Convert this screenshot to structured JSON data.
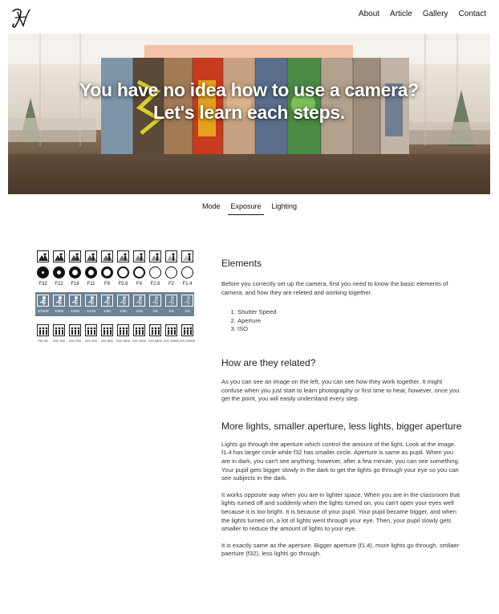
{
  "header": {
    "logo_icon": "signature-logo",
    "nav": [
      "About",
      "Article",
      "Gallery",
      "Contact"
    ]
  },
  "hero": {
    "line1": "You have no idea how to use a camera?",
    "line2": "Let's learn each steps."
  },
  "tabs": [
    {
      "label": "Mode",
      "active": false
    },
    {
      "label": "Exposure",
      "active": true
    },
    {
      "label": "Lighting",
      "active": false
    }
  ],
  "diagram": {
    "apertures": [
      "F32",
      "F22",
      "F16",
      "F11",
      "F8",
      "F5.6",
      "F4",
      "F2.8",
      "F2",
      "F1.4"
    ],
    "shutter_speeds": [
      "1/1000",
      "1/500",
      "1/250",
      "1/125",
      "1/60",
      "1/30",
      "1/15",
      "1/8",
      "1/4",
      "1/2"
    ],
    "iso_values": [
      "ISO 50",
      "ISO 100",
      "ISO 200",
      "ISO 400",
      "ISO 800",
      "ISO 1600",
      "ISO 3200",
      "ISO 6400",
      "ISO 12800",
      "ISO 25600"
    ]
  },
  "sections": [
    {
      "heading": "Elements",
      "paragraphs": [
        "Before you correctly set up the camera, first you need to know the basic elements of camera, and how they are releted and working together."
      ],
      "list": [
        "Shutter Speed",
        "Aperture",
        "ISO"
      ]
    },
    {
      "heading": "How are they related?",
      "paragraphs": [
        "As you can see an image on the left, you can see how they work together. It might confuse when you just start to learn photography or first time to hear, however, once you get the point, you will easily understand every step."
      ]
    },
    {
      "heading": "More lights, smaller aperture, less lights, bigger aperture",
      "paragraphs": [
        "Lights go through the aperture which control the amount of the light. Look at the image. f1.4 has larger circle while f32 has smaller circle. Aperture is same as pupil. When you are in dark, you can't see anything; however, after a few minute, you can see something. Your pupil gets bigger slowly in the dark to get the lights go through your eye so you can see subjects in the dark.",
        "It works opposite way when you are in lighter space. When you are in the classroom that lights turned off and suddenly when the lights turned on, you can't open your eyes well because it is too bright. It is because of your pupil. Your pupil became bigger, and when the lights turned on, a lot of lights went through your eye. Then, your pupil slowly gets smaller to reduce the amount of lights to your eye.",
        "It is exactly same as the aperture. Bigger aperture (f1.4), more lights go through, smllaer paerture (f32), less lights go through."
      ]
    }
  ],
  "colors": {
    "shutter_row_bg": "#6e8394",
    "text": "#333333",
    "heading": "#222222"
  }
}
